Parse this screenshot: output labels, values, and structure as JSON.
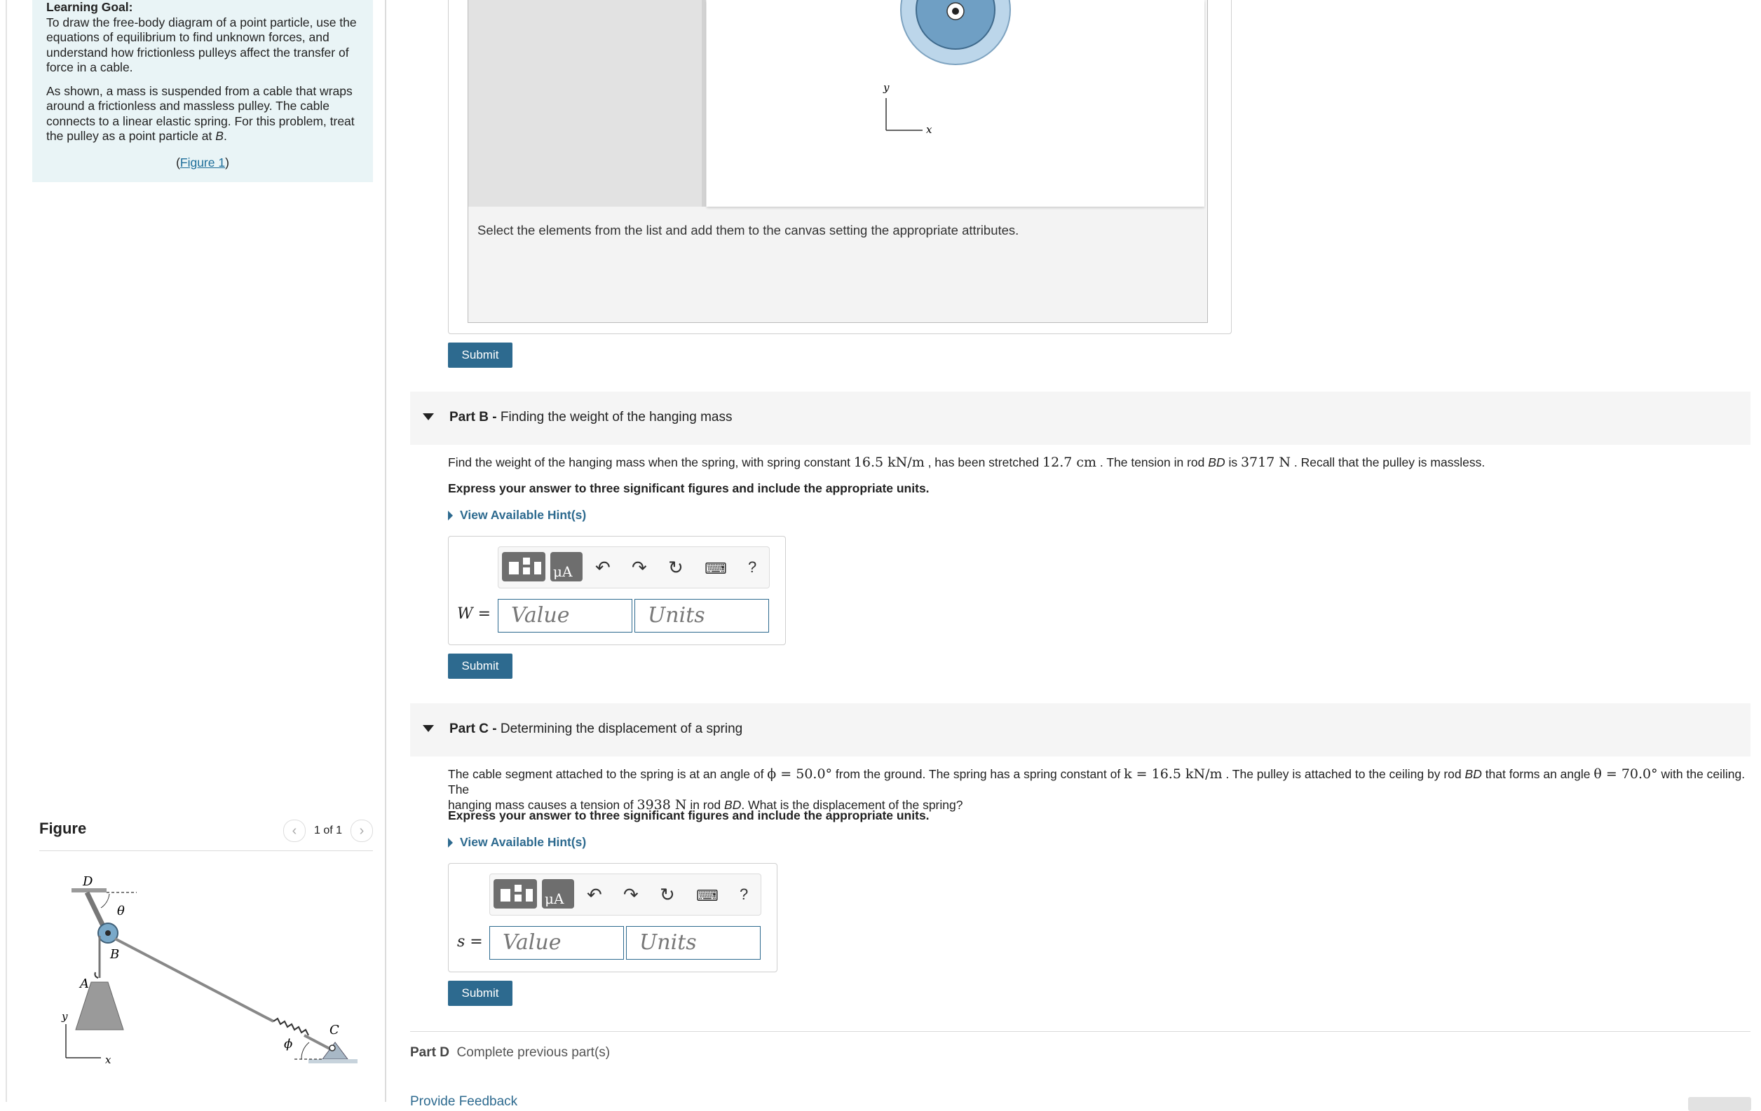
{
  "learning_goal": {
    "heading": "Learning Goal:",
    "text": "To draw the free-body diagram of a point particle, use the equations of equilibrium to find unknown forces, and understand how frictionless pulleys affect the transfer of force in a cable.",
    "desc": "As shown, a mass is suspended from a cable that wraps around a frictionless and massless pulley. The cable connects to a linear elastic spring. For this problem, treat the pulley as a point particle at ",
    "desc_point": "B",
    "desc_end": ".",
    "figure_link_open": "(",
    "figure_link": "Figure 1",
    "figure_link_close": ")"
  },
  "figure": {
    "title": "Figure",
    "pager": "1 of 1",
    "labels": {
      "D": "D",
      "theta": "θ",
      "B": "B",
      "A": "A",
      "y": "y",
      "x": "x",
      "C": "C",
      "phi": "ϕ"
    }
  },
  "part_a": {
    "canvas_axis_y": "y",
    "canvas_axis_x": "x",
    "instruction": "Select the elements from the list and add them to the canvas setting the appropriate attributes.",
    "submit": "Submit"
  },
  "part_b": {
    "label_bold": "Part B -",
    "label": "Finding the weight of the hanging mass",
    "q1": "Find the weight of the hanging mass when the spring, with spring constant ",
    "k": "16.5 kN/m",
    "q2": " , has been stretched ",
    "stretch": "12.7 cm",
    "q3": " . The tension in rod ",
    "rod": "BD",
    "q4": " is ",
    "tension": "3717 N",
    "q5": " . Recall that the pulley is massless.",
    "instruction": "Express your answer to three significant figures and include the appropriate units.",
    "hint": "View Available Hint(s)",
    "var": "W =",
    "value_placeholder": "Value",
    "units_placeholder": "Units",
    "submit": "Submit"
  },
  "part_c": {
    "label_bold": "Part C -",
    "label": "Determining the displacement of a spring",
    "q1": "The cable segment attached to the spring is at an angle of ",
    "phi": "ϕ = 50.0°",
    "q2": " from the ground. The spring has a spring constant of ",
    "k": "k = 16.5 kN/m",
    "q3": " . The pulley is attached to the ceiling by rod ",
    "rod": "BD",
    "q4": " that forms an angle ",
    "theta": "θ = 70.0°",
    "q5": " with the ceiling. The",
    "q6": "hanging mass causes a tension of ",
    "tension": "3938 N",
    "q7": " in rod  ",
    "rod2": "BD",
    "q8": ". What is the displacement of the spring?",
    "instruction": "Express your answer to three significant figures and include the appropriate units.",
    "hint": "View Available Hint(s)",
    "var": "s =",
    "value_placeholder": "Value",
    "units_placeholder": "Units",
    "submit": "Submit"
  },
  "part_d": {
    "label_bold": "Part D",
    "label": "Complete previous part(s)"
  },
  "feedback": "Provide Feedback",
  "toolbar": {
    "mu_label": "μA",
    "help": "?"
  },
  "colors": {
    "accent": "#2d6a8f",
    "goal_bg": "#e9f4f6"
  }
}
